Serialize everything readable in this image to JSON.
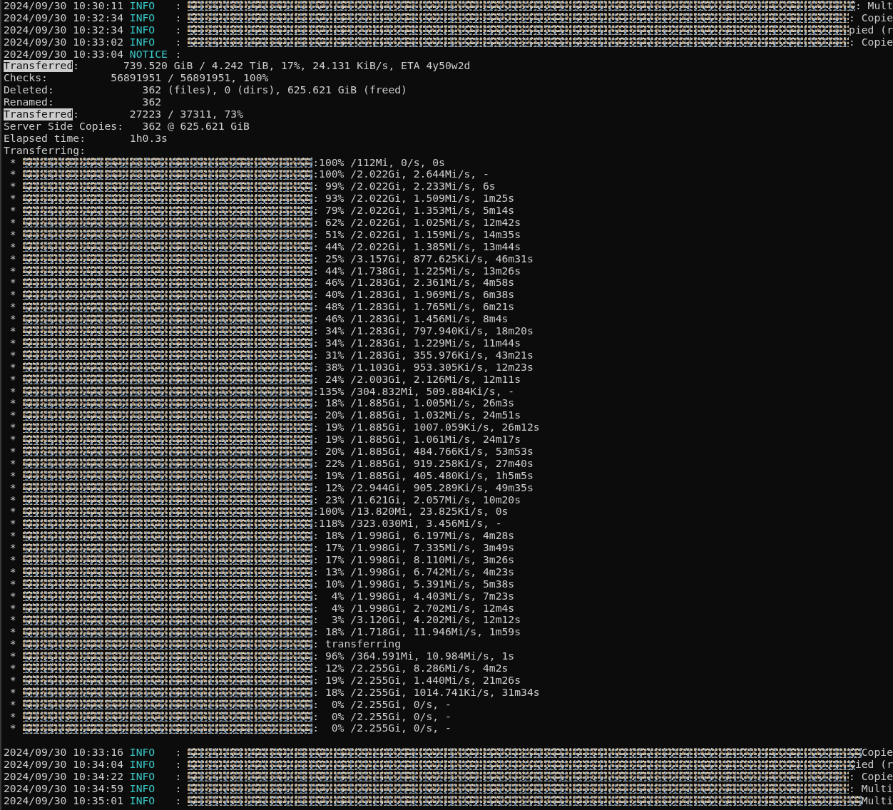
{
  "log_top": [
    {
      "time": "2024/09/30 10:30:11",
      "level": "INFO",
      "sep": ":",
      "redacted": true,
      "tail": ": Mult"
    },
    {
      "time": "2024/09/30 10:32:34",
      "level": "INFO",
      "sep": ":",
      "redacted": true,
      "tail": ": Copie"
    },
    {
      "time": "2024/09/30 10:32:34",
      "level": "INFO",
      "sep": ":",
      "redacted": true,
      "tail": "pied (r"
    },
    {
      "time": "2024/09/30 10:33:02",
      "level": "INFO",
      "sep": ":",
      "redacted": true,
      "tail": ": Copie"
    },
    {
      "time": "2024/09/30 10:33:04",
      "level": "NOTICE",
      "sep": ":",
      "redacted": false
    }
  ],
  "stats": [
    {
      "label": "Transferred",
      "highlighted": true,
      "value": ":       739.520 GiB / 4.242 TiB, 17%, 24.131 KiB/s, ETA 4y50w2d"
    },
    {
      "label": "Checks",
      "highlighted": false,
      "value": ":          56891951 / 56891951, 100%"
    },
    {
      "label": "Deleted",
      "highlighted": false,
      "value": ":              362 (files), 0 (dirs), 625.621 GiB (freed)"
    },
    {
      "label": "Renamed",
      "highlighted": false,
      "value": ":              362"
    },
    {
      "label": "Transferred",
      "highlighted": true,
      "value": ":        27223 / 37311, 73%"
    },
    {
      "label": "Server Side Copies",
      "highlighted": false,
      "value": ":   362 @ 625.621 GiB"
    },
    {
      "label": "Elapsed time",
      "highlighted": false,
      "value": ":       1h0.3s"
    },
    {
      "label": "Transferring",
      "highlighted": false,
      "value": ":"
    }
  ],
  "transfers": [
    {
      "bullet": "*",
      "progress": ":100% /112Mi, 0/s, 0s"
    },
    {
      "bullet": "*",
      "progress": ":100% /2.022Gi, 2.644Mi/s, -"
    },
    {
      "bullet": "*",
      "progress": ": 99% /2.022Gi, 2.233Mi/s, 6s"
    },
    {
      "bullet": "*",
      "progress": ": 93% /2.022Gi, 1.509Mi/s, 1m25s"
    },
    {
      "bullet": "*",
      "progress": ": 79% /2.022Gi, 1.353Mi/s, 5m14s"
    },
    {
      "bullet": "*",
      "progress": ": 62% /2.022Gi, 1.025Mi/s, 12m42s"
    },
    {
      "bullet": "*",
      "progress": ": 51% /2.022Gi, 1.159Mi/s, 14m35s"
    },
    {
      "bullet": "*",
      "progress": ": 44% /2.022Gi, 1.385Mi/s, 13m44s"
    },
    {
      "bullet": "*",
      "progress": ": 25% /3.157Gi, 877.625Ki/s, 46m31s"
    },
    {
      "bullet": "*",
      "progress": ": 44% /1.738Gi, 1.225Mi/s, 13m26s"
    },
    {
      "bullet": "*",
      "progress": ": 46% /1.283Gi, 2.361Mi/s, 4m58s"
    },
    {
      "bullet": "*",
      "progress": ": 40% /1.283Gi, 1.969Mi/s, 6m38s"
    },
    {
      "bullet": "*",
      "progress": ": 48% /1.283Gi, 1.765Mi/s, 6m21s"
    },
    {
      "bullet": "*",
      "progress": ": 46% /1.283Gi, 1.456Mi/s, 8m4s"
    },
    {
      "bullet": "*",
      "progress": ": 34% /1.283Gi, 797.940Ki/s, 18m20s"
    },
    {
      "bullet": "*",
      "progress": ": 34% /1.283Gi, 1.229Mi/s, 11m44s"
    },
    {
      "bullet": "*",
      "progress": ": 31% /1.283Gi, 355.976Ki/s, 43m21s"
    },
    {
      "bullet": "*",
      "progress": ": 38% /1.103Gi, 953.305Ki/s, 12m23s"
    },
    {
      "bullet": "*",
      "progress": ": 24% /2.003Gi, 2.126Mi/s, 12m11s"
    },
    {
      "bullet": "*",
      "progress": ":135% /304.832Mi, 509.884Ki/s, -"
    },
    {
      "bullet": "*",
      "progress": ": 18% /1.885Gi, 1.005Mi/s, 26m3s"
    },
    {
      "bullet": "*",
      "progress": ": 20% /1.885Gi, 1.032Mi/s, 24m51s"
    },
    {
      "bullet": "*",
      "progress": ": 19% /1.885Gi, 1007.059Ki/s, 26m12s"
    },
    {
      "bullet": "*",
      "progress": ": 19% /1.885Gi, 1.061Mi/s, 24m17s"
    },
    {
      "bullet": "*",
      "progress": ": 20% /1.885Gi, 484.766Ki/s, 53m53s"
    },
    {
      "bullet": "*",
      "progress": ": 22% /1.885Gi, 919.258Ki/s, 27m40s"
    },
    {
      "bullet": "*",
      "progress": ": 19% /1.885Gi, 405.480Ki/s, 1h5m5s"
    },
    {
      "bullet": "*",
      "progress": ": 12% /2.944Gi, 905.289Ki/s, 49m35s"
    },
    {
      "bullet": "*",
      "progress": ": 23% /1.621Gi, 2.057Mi/s, 10m20s"
    },
    {
      "bullet": "*",
      "progress": ":100% /13.820Mi, 23.825Ki/s, 0s"
    },
    {
      "bullet": "*",
      "progress": ":118% /323.030Mi, 3.456Mi/s, -"
    },
    {
      "bullet": "*",
      "progress": ": 18% /1.998Gi, 6.197Mi/s, 4m28s"
    },
    {
      "bullet": "*",
      "progress": ": 17% /1.998Gi, 7.335Mi/s, 3m49s"
    },
    {
      "bullet": "*",
      "progress": ": 17% /1.998Gi, 8.110Mi/s, 3m26s"
    },
    {
      "bullet": "*",
      "progress": ": 13% /1.998Gi, 6.742Mi/s, 4m23s"
    },
    {
      "bullet": "*",
      "progress": ": 10% /1.998Gi, 5.391Mi/s, 5m38s"
    },
    {
      "bullet": "*",
      "progress": ":  4% /1.998Gi, 4.403Mi/s, 7m23s"
    },
    {
      "bullet": "*",
      "progress": ":  4% /1.998Gi, 2.702Mi/s, 12m4s"
    },
    {
      "bullet": "*",
      "progress": ":  3% /3.120Gi, 4.202Mi/s, 12m12s"
    },
    {
      "bullet": "*",
      "progress": ": 18% /1.718Gi, 11.946Mi/s, 1m59s"
    },
    {
      "bullet": "*",
      "progress": ": transferring"
    },
    {
      "bullet": "*",
      "progress": ": 96% /364.591Mi, 10.984Mi/s, 1s"
    },
    {
      "bullet": "*",
      "progress": ": 12% /2.255Gi, 8.286Mi/s, 4m2s"
    },
    {
      "bullet": "*",
      "progress": ": 19% /2.255Gi, 1.440Mi/s, 21m26s"
    },
    {
      "bullet": "*",
      "progress": ": 18% /2.255Gi, 1014.741Ki/s, 31m34s"
    },
    {
      "bullet": "*",
      "progress": ":  0% /2.255Gi, 0/s, -"
    },
    {
      "bullet": "*",
      "progress": ":  0% /2.255Gi, 0/s, -"
    },
    {
      "bullet": "*",
      "progress": ":  0% /2.255Gi, 0/s, -"
    }
  ],
  "log_bottom": [
    {
      "time": "2024/09/30 10:33:16",
      "level": "INFO",
      "sep": ":",
      "redacted": true,
      "tail": "Copie"
    },
    {
      "time": "2024/09/30 10:34:04",
      "level": "INFO",
      "sep": ":",
      "redacted": true,
      "tail": "ied (r"
    },
    {
      "time": "2024/09/30 10:34:22",
      "level": "INFO",
      "sep": ":",
      "redacted": true,
      "tail": ": Copie"
    },
    {
      "time": "2024/09/30 10:34:59",
      "level": "INFO",
      "sep": ":",
      "redacted": true,
      "tail": ": Multi"
    },
    {
      "time": "2024/09/30 10:35:01",
      "level": "INFO",
      "sep": ":",
      "redacted": true,
      "tail": "Multi"
    }
  ]
}
